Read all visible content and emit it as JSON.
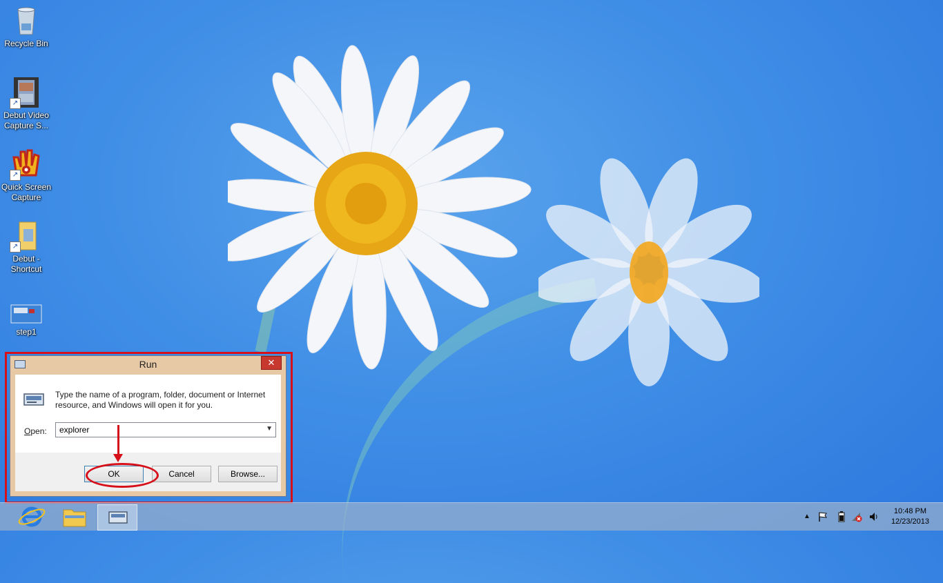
{
  "desktop": {
    "icons": [
      {
        "label": "Recycle Bin"
      },
      {
        "label": "Debut Video Capture S..."
      },
      {
        "label": "Quick Screen Capture"
      },
      {
        "label": "Debut - Shortcut"
      },
      {
        "label": "step1"
      }
    ]
  },
  "dialog": {
    "title": "Run",
    "close_symbol": "✕",
    "description": "Type the name of a program, folder, document or Internet resource, and Windows will open it for you.",
    "open_label_prefix": "O",
    "open_label_rest": "pen:",
    "open_value": "explorer",
    "ok_label": "OK",
    "cancel_label": "Cancel",
    "browse_label": "Browse..."
  },
  "taskbar": {
    "apps": [
      "internet-explorer-icon",
      "file-explorer-icon",
      "run-dialog-icon"
    ],
    "clock_time": "10:48 PM",
    "clock_date": "12/23/2013"
  },
  "annotation_color": "#d60f19"
}
